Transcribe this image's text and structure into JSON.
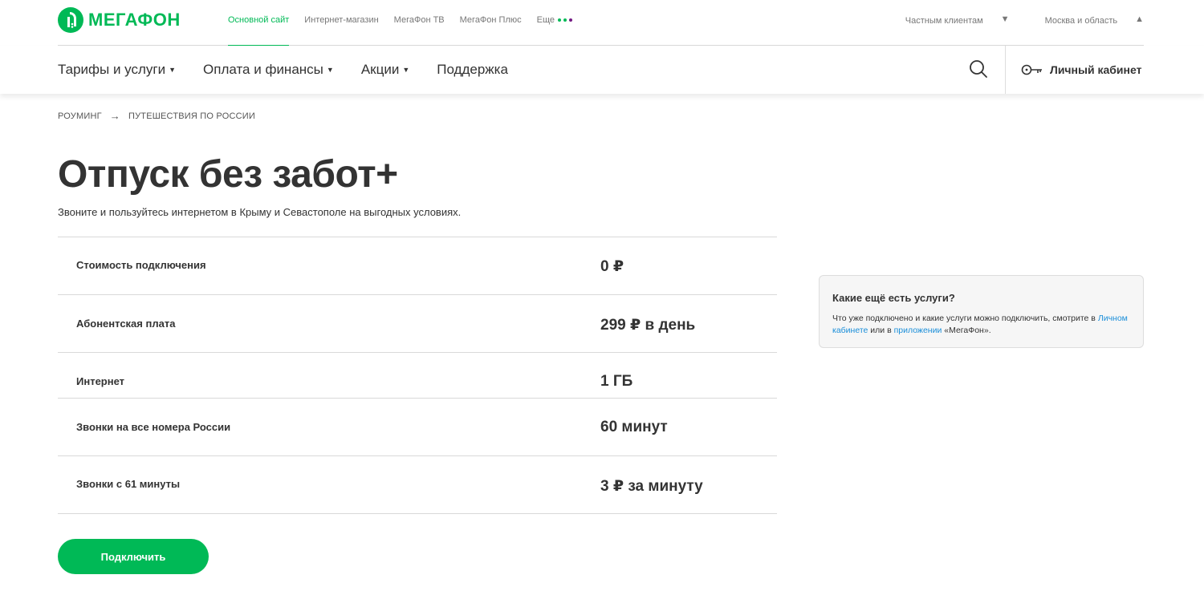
{
  "brand": {
    "name": "МегаФон",
    "color": "#00b956"
  },
  "topnav": {
    "items": [
      "Основной сайт",
      "Интернет-магазин",
      "МегаФон ТВ",
      "МегаФон Плюс",
      "Еще"
    ],
    "more_dots_colors": [
      "#00b956",
      "#00b956",
      "#731982"
    ],
    "right": {
      "clients": "Частным клиентам",
      "region": "Москва и область"
    }
  },
  "mainnav": {
    "items": [
      "Тарифы и услуги",
      "Оплата и финансы",
      "Акции",
      "Поддержка"
    ],
    "cabinet_label": "Личный кабинет",
    "icons": [
      "search-icon",
      "key-icon"
    ]
  },
  "breadcrumb": [
    "РОУМИНГ",
    "ПУТЕШЕСТВИЯ ПО РОССИИ"
  ],
  "page": {
    "title": "Отпуск без забот+",
    "subtitle": "Звоните и пользуйтесь интернетом в Крыму и Севастополе на выгодных условиях."
  },
  "table": {
    "rows": [
      {
        "label": "Стоимость подключения",
        "value": "0 ₽"
      },
      {
        "label": "Абонентская плата",
        "value": "299 ₽ в день"
      },
      {
        "label": "Интернет",
        "value": "1 ГБ"
      },
      {
        "label": "Звонки на все номера России",
        "value": "60 минут"
      },
      {
        "label": "Звонки с 61 минуты",
        "value": "3 ₽ за минуту"
      }
    ]
  },
  "card": {
    "title": "Какие ещё есть услуги?",
    "text_1": "Что уже подключено и какие услуги можно подключить, смотрите в",
    "link_1": "Личном кабинете",
    "text_2": "или в",
    "link_2": "приложении",
    "text_3": "«МегаФон».",
    "link_color": "#1a8ed9"
  },
  "connect_button": "Подключить"
}
